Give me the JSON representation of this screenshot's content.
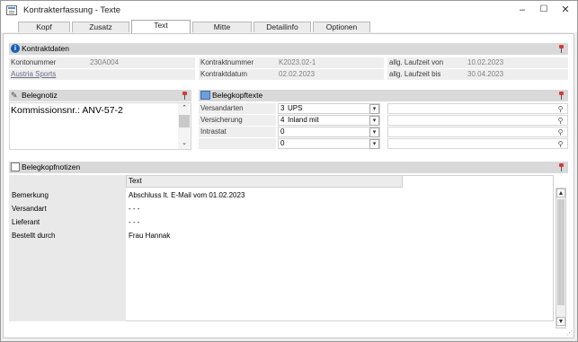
{
  "window": {
    "title": "Kontrakterfassung - Texte",
    "minimize": "–",
    "maximize": "☐",
    "close": "✕"
  },
  "tabs": [
    {
      "label": "Kopf"
    },
    {
      "label": "Zusatz"
    },
    {
      "label": "Text"
    },
    {
      "label": "Mitte"
    },
    {
      "label": "Detailinfo"
    },
    {
      "label": "Optionen"
    }
  ],
  "kontraktdaten": {
    "title": "Kontraktdaten",
    "kontonummer_label": "Kontonummer",
    "kontonummer_value": "230A004",
    "name_value": "Austria Sports",
    "kontraktnummer_label": "Kontraktnummer",
    "kontraktnummer_value": "K2023.02-1",
    "kontraktdatum_label": "Kontraktdatum",
    "kontraktdatum_value": "02.02.2023",
    "laufzeit_von_label": "allg. Laufzeit von",
    "laufzeit_von_value": "10.02.2023",
    "laufzeit_bis_label": "allg. Laufzeit bis",
    "laufzeit_bis_value": "30.04.2023"
  },
  "belegnotiz": {
    "title": "Belegnotiz",
    "text": "Kommissionsnr.: ANV-57-2"
  },
  "belegkopftexte": {
    "title": "Belegkopftexte",
    "rows": [
      {
        "label": "Versandarten",
        "code": "3",
        "value": "UPS"
      },
      {
        "label": "Versicherung",
        "code": "4",
        "value": "Inland mit"
      },
      {
        "label": "Intrastat",
        "code": "0",
        "value": ""
      },
      {
        "label": "",
        "code": "0",
        "value": ""
      }
    ]
  },
  "belegkopfnotizen": {
    "title": "Belegkopfnotizen",
    "column_header": "Text",
    "rows": [
      {
        "label": "Bemerkung",
        "text": "Abschluss lt. E-Mail vom 01.02.2023"
      },
      {
        "label": "Versandart",
        "text": "- - -"
      },
      {
        "label": "Lieferant",
        "text": "- - -"
      },
      {
        "label": "Bestellt durch",
        "text": "Frau Hannak"
      }
    ]
  },
  "colors": {
    "section_bar": "#d9d9d9",
    "info_icon": "#1a5fb4",
    "pin": "#d23b3b"
  }
}
